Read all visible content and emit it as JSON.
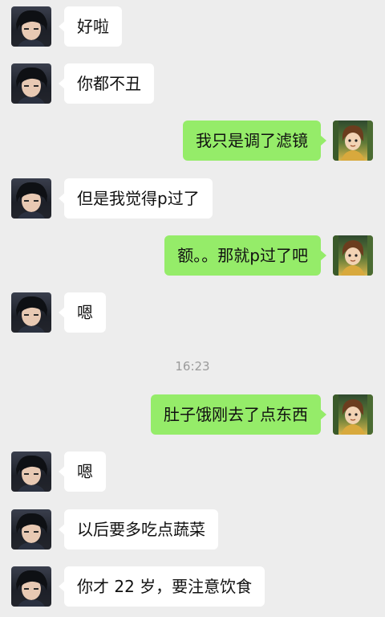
{
  "chat": {
    "timestamp": "16:23",
    "messages": [
      {
        "side": "left",
        "avatar": "avatar-contact",
        "text": "好啦"
      },
      {
        "side": "left",
        "avatar": "avatar-contact",
        "text": "你都不丑"
      },
      {
        "side": "right",
        "avatar": "avatar-self",
        "text": "我只是调了滤镜"
      },
      {
        "side": "left",
        "avatar": "avatar-contact",
        "text": "但是我觉得p过了"
      },
      {
        "side": "right",
        "avatar": "avatar-self",
        "text": "额。。那就p过了吧"
      },
      {
        "side": "left",
        "avatar": "avatar-contact",
        "text": "嗯"
      },
      {
        "side": "right",
        "avatar": "avatar-self",
        "text": "肚子饿刚去了点东西"
      },
      {
        "side": "left",
        "avatar": "avatar-contact",
        "text": "嗯"
      },
      {
        "side": "left",
        "avatar": "avatar-contact",
        "text": "以后要多吃点蔬菜"
      },
      {
        "side": "left",
        "avatar": "avatar-contact",
        "text": "你才 22 岁，要注意饮食"
      }
    ]
  }
}
